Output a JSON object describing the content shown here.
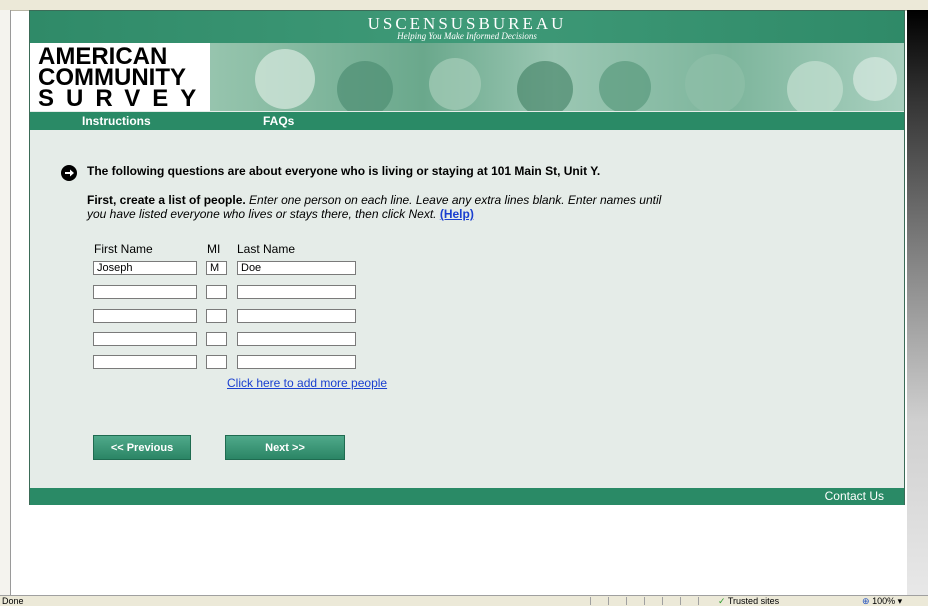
{
  "header": {
    "agency": "USCENSUSBUREAU",
    "tagline": "Helping You Make Informed Decisions",
    "logo": [
      "AMERICAN",
      "COMMUNITY",
      "SURVEY"
    ]
  },
  "nav": {
    "instructions": "Instructions",
    "faqs": "FAQs"
  },
  "question": {
    "heading": "The following questions are about everyone who is living or staying at 101 Main St, Unit Y.",
    "instruction_bold": "First, create a list of people.",
    "instruction_italic": " Enter one person on each line. Leave any extra lines blank. Enter names until you have listed everyone who lives or stays there, then click Next. ",
    "help_link": "(Help)"
  },
  "table": {
    "headers": {
      "first": "First Name",
      "mi": "MI",
      "last": "Last Name"
    },
    "rows": [
      {
        "first": "Joseph",
        "mi": "M",
        "last": "Doe"
      },
      {
        "first": "",
        "mi": "",
        "last": ""
      },
      {
        "first": "",
        "mi": "",
        "last": ""
      },
      {
        "first": "",
        "mi": "",
        "last": ""
      },
      {
        "first": "",
        "mi": "",
        "last": ""
      }
    ]
  },
  "add_more": "Click here to add more people",
  "buttons": {
    "previous": "<<  Previous",
    "next": "Next  >>"
  },
  "footer": {
    "contact": "Contact Us"
  },
  "statusbar": {
    "status": "Done",
    "zone": "Trusted sites",
    "zoom": "100%"
  },
  "colors": {
    "green": "#2a8a66",
    "link": "#1a3fd0",
    "background": "#e5ece8"
  }
}
